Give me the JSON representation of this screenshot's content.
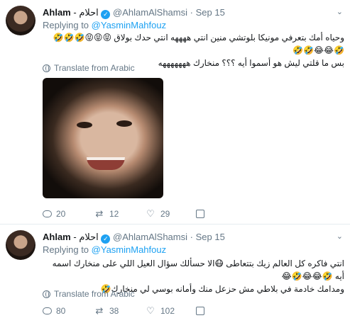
{
  "tweets": [
    {
      "name": "Ahlam",
      "name_ar": "احلام",
      "handle": "@AhlamAlShamsi",
      "sep": "·",
      "date": "Sep 15",
      "replying_prefix": "Replying to",
      "replying_to": "@YasminMahfouz",
      "text_line1": "وحياه أمك بتعرفي مونيكا بلوتشي منين انتي ههههه انتي حدك بولاق 😝😝😝🤣🤣🤣🤣😂😂🤣🤣",
      "text_line2": "بس ما قلتي ليش هو أسموا أيه ؟؟؟ منخارك هههههههه",
      "translate": "Translate from Arabic",
      "replies": "20",
      "retweets": "12",
      "likes": "29"
    },
    {
      "name": "Ahlam",
      "name_ar": "احلام",
      "handle": "@AhlamAlShamsi",
      "sep": "·",
      "date": "Sep 15",
      "replying_prefix": "Replying to",
      "replying_to": "@YasminMahfouz",
      "text_line1": "انتي فاكره كل العالم زيك بتتعاطى 😷الا حسألك سؤال العيل اللي على منخارك اسمه أيه 🤣😂😂🤣😂",
      "text_line2": "ومدامك خادمة في بلاطي مش حزعل منك وأمانه بوسي لي منخارك🤣",
      "translate": "Translate from Arabic",
      "replies": "80",
      "retweets": "38",
      "likes": "102"
    }
  ],
  "icons": {
    "reply": "reply-icon",
    "retweet": "retweet-icon",
    "like": "heart-icon",
    "dm": "direct-message-icon",
    "verified": "verified-badge-icon",
    "globe": "globe-icon",
    "more": "chevron-down-icon"
  },
  "colors": {
    "link": "#1da1f2",
    "muted": "#657786",
    "retweet_icon": "#17bf63"
  }
}
